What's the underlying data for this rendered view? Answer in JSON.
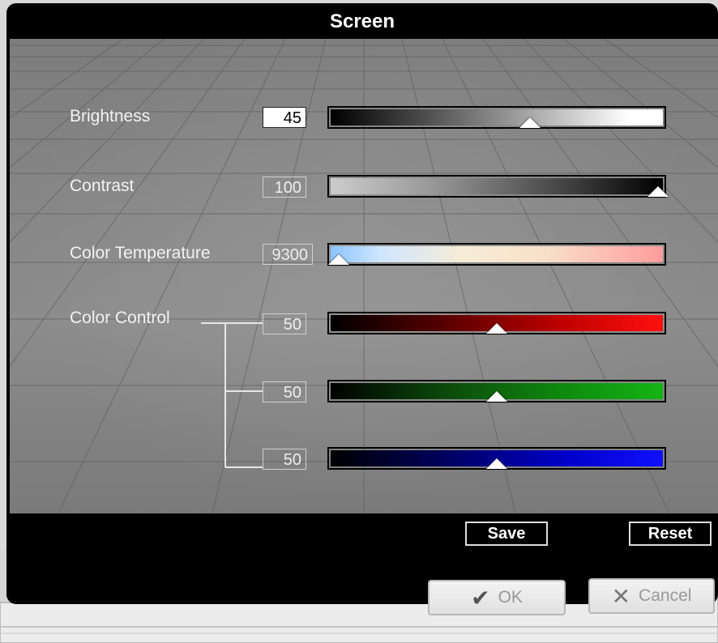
{
  "window": {
    "title": "Screen"
  },
  "settings": {
    "brightness": {
      "label": "Brightness",
      "value": "45",
      "level": 0.6
    },
    "contrast": {
      "label": "Contrast",
      "value": "100",
      "level": 0.98
    },
    "color_temperature": {
      "label": "Color Temperature",
      "value": "9300",
      "level": 0.03
    },
    "color_control": {
      "label": "Color Control",
      "red": {
        "value": "50",
        "level": 0.5,
        "color": "#ff1010"
      },
      "green": {
        "value": "50",
        "level": 0.5,
        "color": "#14b414"
      },
      "blue": {
        "value": "50",
        "level": 0.5,
        "color": "#1010ff"
      }
    }
  },
  "footer": {
    "save_label": "Save",
    "reset_label": "Reset"
  },
  "dialog": {
    "ok_label": "OK",
    "cancel_label": "Cancel",
    "ok_icon": "checkmark-icon",
    "cancel_icon": "x-icon"
  }
}
